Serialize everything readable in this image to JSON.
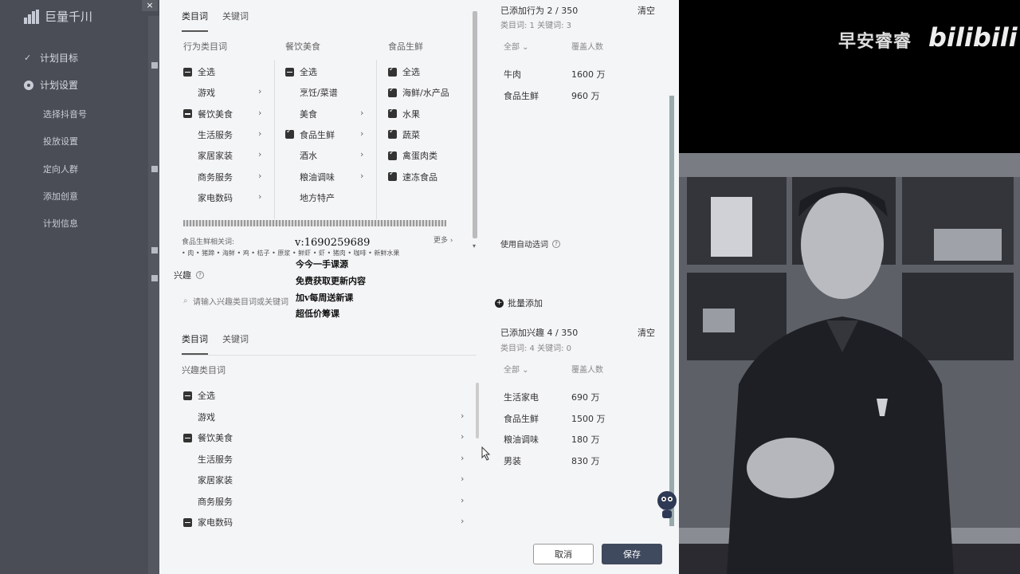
{
  "app": {
    "logo_text": "巨量千川",
    "close_glyph": "×",
    "nav": [
      {
        "label": "计划目标",
        "level": "top",
        "icon": "check-icon"
      },
      {
        "label": "计划设置",
        "level": "top",
        "icon": "gear-icon"
      },
      {
        "label": "选择抖音号",
        "level": "sub"
      },
      {
        "label": "投放设置",
        "level": "sub"
      },
      {
        "label": "定向人群",
        "level": "sub"
      },
      {
        "label": "添加创意",
        "level": "sub"
      },
      {
        "label": "计划信息",
        "level": "sub"
      }
    ]
  },
  "behavior": {
    "tabs": [
      "类目词",
      "关键词"
    ],
    "columns": {
      "col1": {
        "title": "行为类目词",
        "items": [
          {
            "label": "全选",
            "state": "indeterminate"
          },
          {
            "label": "游戏",
            "state": "none"
          },
          {
            "label": "餐饮美食",
            "state": "indeterminate"
          },
          {
            "label": "生活服务",
            "state": "none"
          },
          {
            "label": "家居家装",
            "state": "none"
          },
          {
            "label": "商务服务",
            "state": "none"
          },
          {
            "label": "家电数码",
            "state": "none"
          }
        ]
      },
      "col2": {
        "title": "餐饮美食",
        "items": [
          {
            "label": "全选",
            "state": "indeterminate"
          },
          {
            "label": "烹饪/菜谱",
            "state": "none"
          },
          {
            "label": "美食",
            "state": "none"
          },
          {
            "label": "食品生鲜",
            "state": "checked"
          },
          {
            "label": "酒水",
            "state": "none"
          },
          {
            "label": "粮油调味",
            "state": "none"
          },
          {
            "label": "地方特产",
            "state": "none"
          }
        ]
      },
      "col3": {
        "title": "食品生鲜",
        "items": [
          {
            "label": "全选",
            "state": "checked"
          },
          {
            "label": "海鲜/水产品",
            "state": "checked"
          },
          {
            "label": "水果",
            "state": "checked"
          },
          {
            "label": "蔬菜",
            "state": "checked"
          },
          {
            "label": "禽蛋肉类",
            "state": "checked"
          },
          {
            "label": "速冻食品",
            "state": "checked"
          }
        ]
      }
    },
    "related_label": "食品生鲜相关词:",
    "related_more": "更多",
    "related_words": [
      "肉",
      "猪蹄",
      "海鲜",
      "鸡",
      "桔子",
      "原浆",
      "鲜虾",
      "虾",
      "猪肉",
      "咖啡",
      "新鲜水果"
    ],
    "added_summary": "已添加行为 2 / 350",
    "clear_label": "清空",
    "summary_sub": "类目词: 1    关键词: 3",
    "table_header": [
      "全部",
      "覆盖人数"
    ],
    "added_items": [
      {
        "name": "牛肉",
        "value": "1600 万"
      },
      {
        "name": "食品生鲜",
        "value": "960 万"
      }
    ],
    "auto_select_label": "使用自动选词"
  },
  "overlay": {
    "contact": "v:1690259689",
    "lines": [
      "今今一手课源",
      "免费获取更新内容",
      "加v每周送新课",
      "超低价筹课"
    ]
  },
  "interest": {
    "title": "兴趣",
    "search_placeholder": "请输入兴趣类目词或关键词",
    "batch_add_label": "批量添加",
    "tabs": [
      "类目词",
      "关键词"
    ],
    "column_title": "兴趣类目词",
    "items": [
      {
        "label": "全选",
        "state": "indeterminate"
      },
      {
        "label": "游戏",
        "state": "none"
      },
      {
        "label": "餐饮美食",
        "state": "indeterminate"
      },
      {
        "label": "生活服务",
        "state": "none"
      },
      {
        "label": "家居家装",
        "state": "none"
      },
      {
        "label": "商务服务",
        "state": "none"
      },
      {
        "label": "家电数码",
        "state": "indeterminate"
      }
    ],
    "added_summary": "已添加兴趣 4 / 350",
    "clear_label": "清空",
    "summary_sub": "类目词: 4    关键词: 0",
    "table_header": [
      "全部",
      "覆盖人数"
    ],
    "added_items": [
      {
        "name": "生活家电",
        "value": "690 万"
      },
      {
        "name": "食品生鲜",
        "value": "1500 万"
      },
      {
        "name": "粮油调味",
        "value": "180 万"
      },
      {
        "name": "男装",
        "value": "830 万"
      }
    ]
  },
  "footer": {
    "cancel": "取消",
    "save": "保存"
  },
  "watermark": {
    "text": "早安睿睿",
    "logo": "bilibili"
  },
  "colors": {
    "panel_bg": "#f4f5f7",
    "sidebar_bg": "#4a4d55",
    "save_btn": "#404a5e"
  }
}
